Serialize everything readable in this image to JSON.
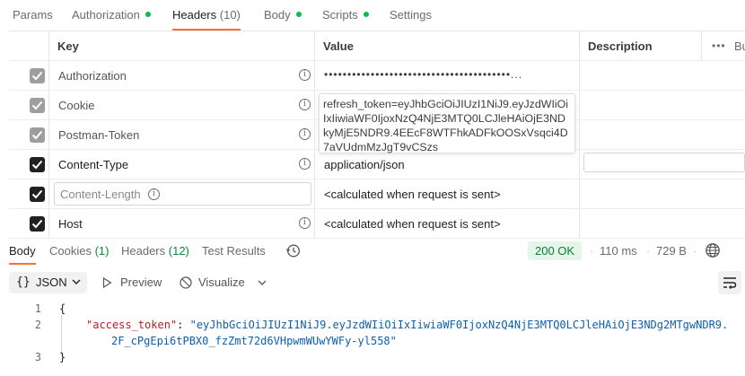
{
  "request_tabs": [
    {
      "label": "Params",
      "count": "",
      "dot": false,
      "active": false
    },
    {
      "label": "Authorization",
      "count": "",
      "dot": true,
      "active": false
    },
    {
      "label": "Headers",
      "count": "(10)",
      "dot": false,
      "active": true
    },
    {
      "label": "Body",
      "count": "",
      "dot": true,
      "active": false
    },
    {
      "label": "Scripts",
      "count": "",
      "dot": true,
      "active": false
    },
    {
      "label": "Settings",
      "count": "",
      "dot": false,
      "active": false
    }
  ],
  "headers_table": {
    "columns": {
      "key": "Key",
      "value": "Value",
      "description": "Description"
    },
    "bulk_edit_label": "Bu",
    "rows": [
      {
        "key": "Authorization",
        "value": "••••••••••••••••••••••••••••••••••••••••...",
        "checked": true
      },
      {
        "key": "Cookie",
        "value": "refresh_token=eyJhbGciOiJIUzI1NiJ9.eyJzdWIiOiIxIiwiaWF0IjoxNzQ4NjE3MTQ0LCJleHAiOjE3NDkyMjE5NDR9.4EEcF8WTFhkADFkOOSxVsqci4D7aVUdmMzJgT9vCSzs",
        "checked": true
      },
      {
        "key": "Postman-Token",
        "value": "",
        "checked": true
      },
      {
        "key": "Content-Type",
        "value": "application/json",
        "checked": true
      },
      {
        "key": "Content-Length",
        "value": "<calculated when request is sent>",
        "checked": true
      },
      {
        "key": "Host",
        "value": "<calculated when request is sent>",
        "checked": true
      }
    ]
  },
  "response": {
    "tabs": [
      {
        "label": "Body",
        "count": "",
        "active": true
      },
      {
        "label": "Cookies",
        "count": "(1)",
        "active": false
      },
      {
        "label": "Headers",
        "count": "(12)",
        "active": false
      },
      {
        "label": "Test Results",
        "count": "",
        "active": false
      }
    ],
    "status": "200 OK",
    "time": "110 ms",
    "size": "729 B",
    "format": "JSON",
    "preview_label": "Preview",
    "visualize_label": "Visualize",
    "body_lines": {
      "l1": "{",
      "key": "\"access_token\"",
      "colon": ": ",
      "value_part1": "\"eyJhbGciOiJIUzI1NiJ9.eyJzdWIiOiIxIiwiaWF0IjoxNzQ4NjE3MTQ0LCJleHAiOjE3NDg2MTgwNDR9.",
      "value_part2": "2F_cPgEpi6tPBX0_fzZmt72d6VHpwmWUwYWFy-yl558\"",
      "l3": "}",
      "numbers": [
        "1",
        "2",
        "3"
      ]
    }
  },
  "colors": {
    "accent": "#ff6c37",
    "dot": "#0cbb52",
    "status_bg": "#e6f5ea",
    "status_fg": "#0a7d33",
    "json_key": "#b31f24",
    "json_string": "#0b5fb0"
  }
}
